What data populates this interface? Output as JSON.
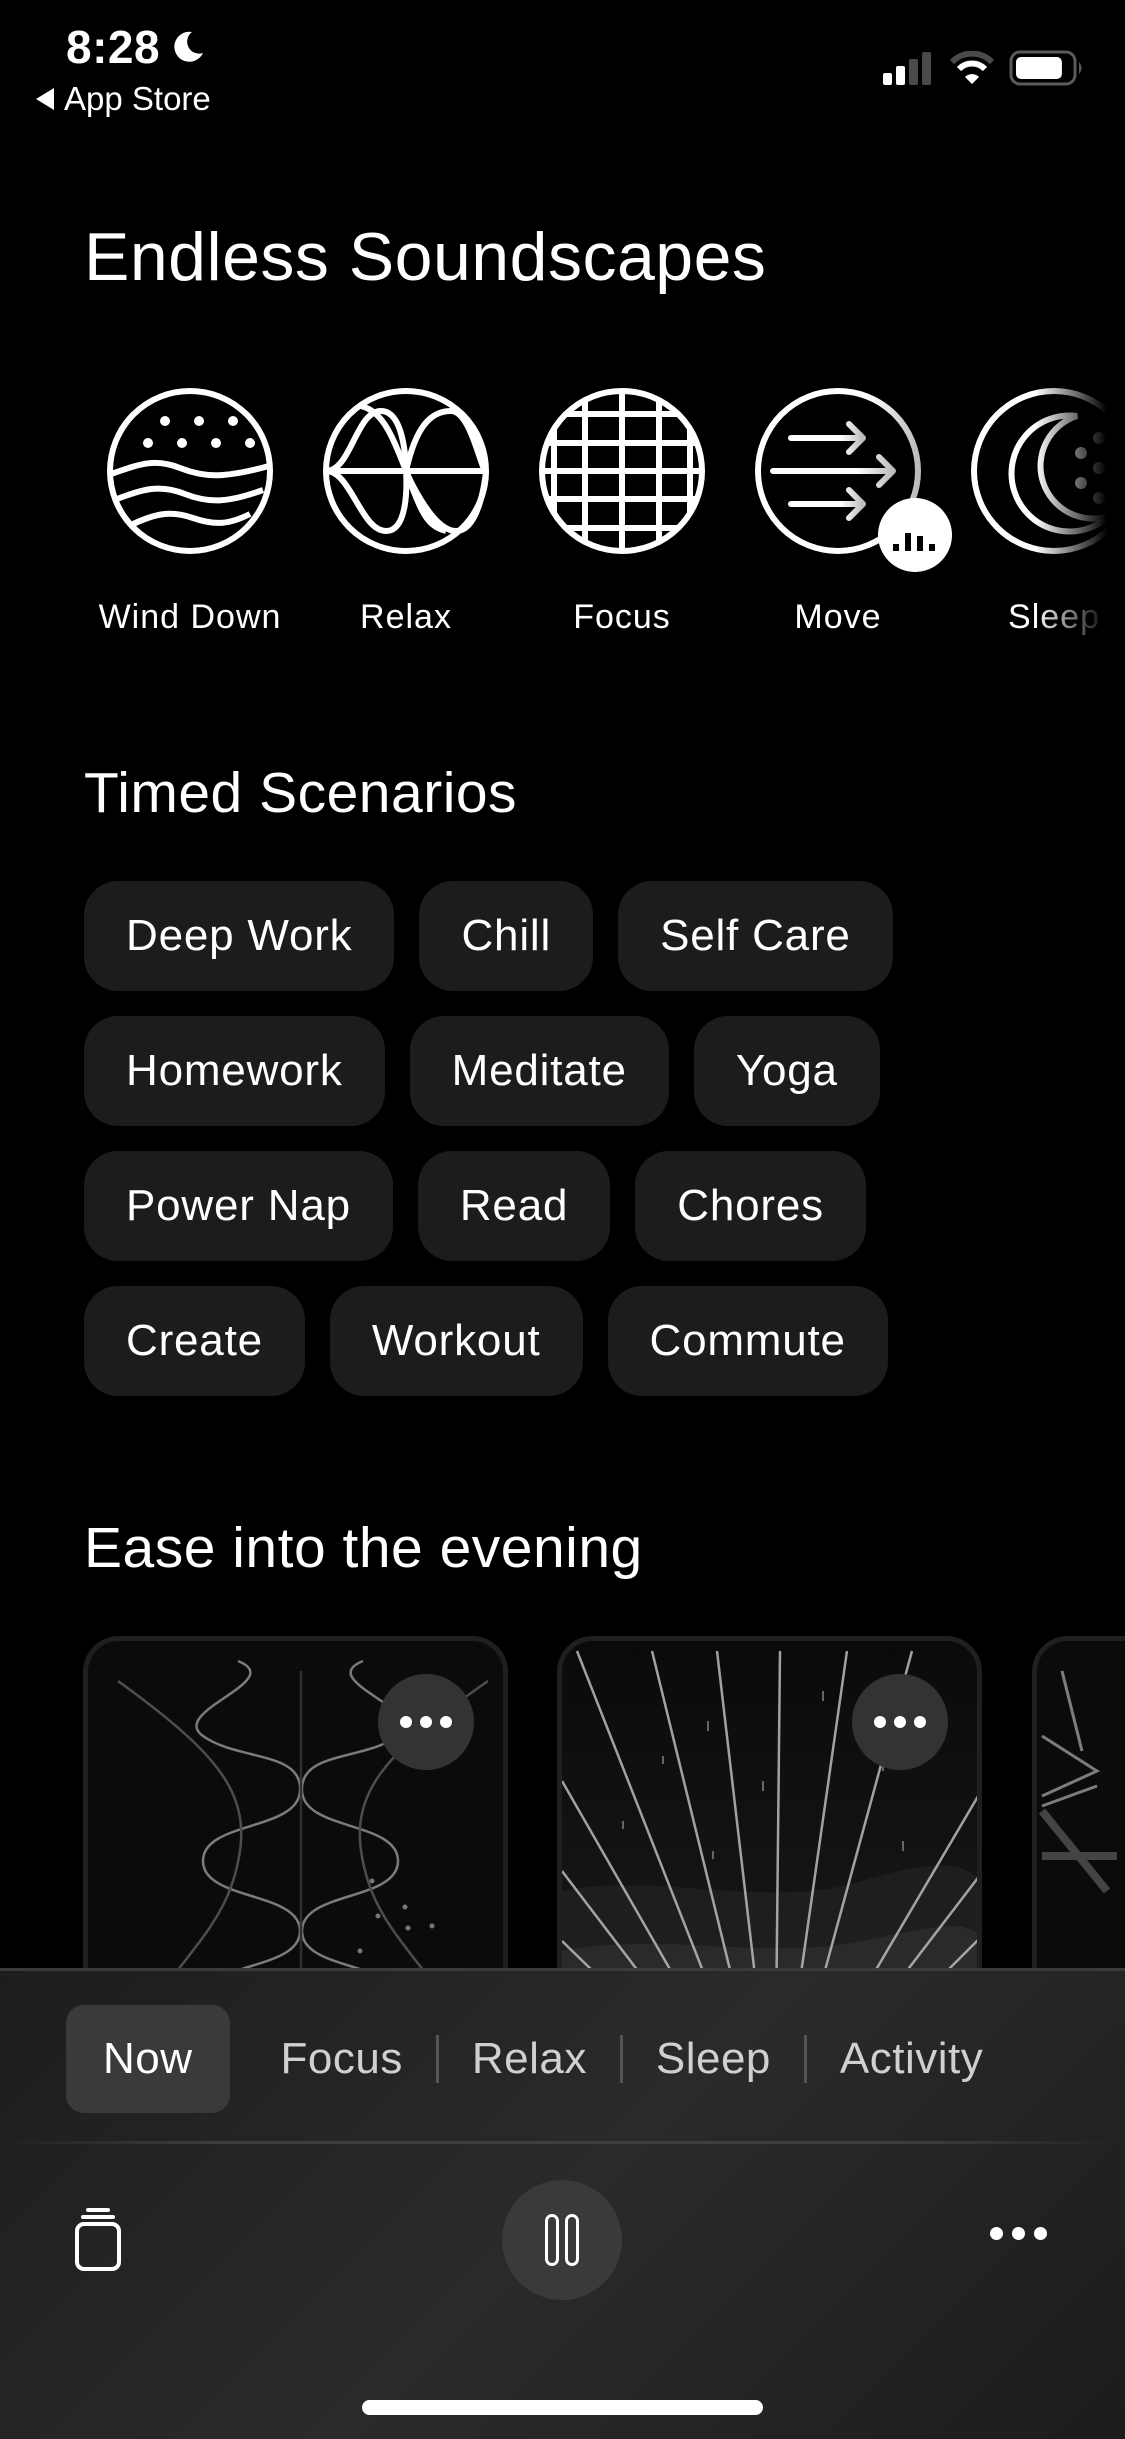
{
  "status_bar": {
    "time": "8:28",
    "focus_icon": "moon-icon",
    "back_label": "App Store",
    "signal_bars_active": 2,
    "signal_bars_total": 4,
    "wifi_level": 2,
    "battery_percent": 85
  },
  "header": {
    "title": "Endless Soundscapes"
  },
  "soundscapes": [
    {
      "label": "Wind Down",
      "icon": "waves-stars-icon"
    },
    {
      "label": "Relax",
      "icon": "sine-waves-icon"
    },
    {
      "label": "Focus",
      "icon": "grid-globe-icon"
    },
    {
      "label": "Move",
      "icon": "arrows-icon",
      "now_playing_badge": "equalizer-icon"
    },
    {
      "label": "Sleep",
      "icon": "moon-dots-icon"
    }
  ],
  "timed_scenarios": {
    "title": "Timed Scenarios",
    "rows": [
      [
        "Deep Work",
        "Chill",
        "Self Care"
      ],
      [
        "Homework",
        "Meditate",
        "Yoga"
      ],
      [
        "Power Nap",
        "Read",
        "Chores"
      ],
      [
        "Create",
        "Workout",
        "Commute"
      ]
    ]
  },
  "evening": {
    "title": "Ease into the evening",
    "cards": [
      {
        "art": "sine-waves-art",
        "more_icon": "more-horizontal-icon"
      },
      {
        "art": "sunrays-art",
        "more_icon": "more-horizontal-icon"
      },
      {
        "art": "geometric-art"
      }
    ]
  },
  "tab_bar": {
    "tabs": [
      {
        "label": "Now",
        "active": true
      },
      {
        "label": "Focus",
        "active": false
      },
      {
        "label": "Relax",
        "active": false
      },
      {
        "label": "Sleep",
        "active": false
      },
      {
        "label": "Activity",
        "active": false
      }
    ]
  },
  "player": {
    "left_icon": "stack-icon",
    "center_icon": "pause-icon",
    "right_icon": "more-horizontal-icon"
  },
  "colors": {
    "background": "#000000",
    "chip_bg": "#1c1c1c",
    "panel_bg": "#232323",
    "active_tab_bg": "#3a3a3a",
    "text": "#ffffff"
  }
}
